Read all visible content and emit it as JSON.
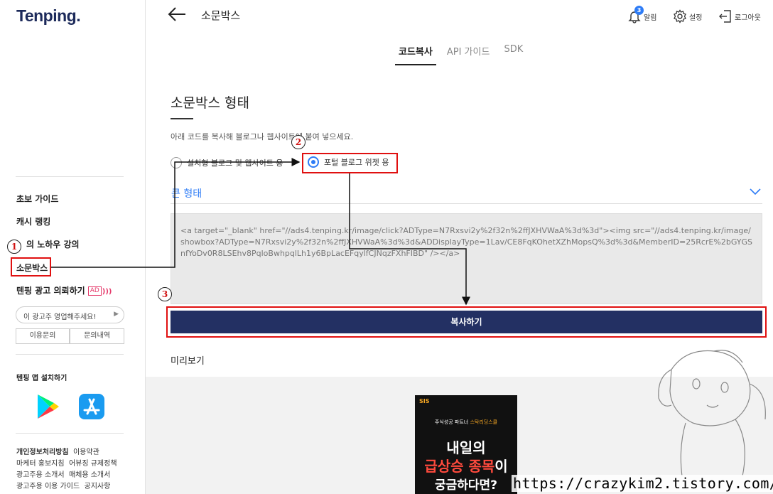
{
  "logo": "Tenping.",
  "sidebar": {
    "menu": [
      "초보 가이드",
      "캐시 랭킹",
      "의 노하우 강의",
      "소문박스"
    ],
    "ad_request_label": "텐핑 광고 의뢰하기",
    "ad_badge": "AD",
    "ad_input_placeholder": "이 광고주 영업해주세요!",
    "inquiry_buttons": [
      "이용문의",
      "문의내역"
    ],
    "app_install_title": "텐핑 앱 설치하기",
    "footer_lines": [
      [
        "개인정보처리방침",
        "이용약관"
      ],
      [
        "마케터 홍보지침",
        "어뷰징 규제정책"
      ],
      [
        "광고주용 소개서",
        "매체용 소개서"
      ],
      [
        "광고주용 이용 가이드",
        "공지사항"
      ]
    ]
  },
  "header": {
    "title": "소문박스",
    "notification_count": "3",
    "notification_label": "알림",
    "settings_label": "설정",
    "logout_label": "로그아웃"
  },
  "tabs": [
    "코드복사",
    "API 가이드",
    "SDK"
  ],
  "active_tab": "코드복사",
  "main": {
    "section_title": "소문박스 형태",
    "description": "아래 코드를 복사해 블로그나 웹사이트에 붙여 넣으세요.",
    "radio_options": [
      "설치형 블로그 및 웹사이트 용",
      "포털 블로그 위젯 용"
    ],
    "selected_radio": "포털 블로그 위젯 용",
    "size_dropdown_value": "큰 형태",
    "code": "<a target=\"_blank\" href=\"//ads4.tenping.kr/image/click?ADType=N7Rxsvi2y%2f32n%2ffJXHVWaA%3d%3d\"><img src=\"//ads4.tenping.kr/image/showbox?ADType=N7Rxsvi2y%2f32n%2ffJXHVWaA%3d%3d&ADDisplayType=1Lav/CE8FqKOhetXZhMopsQ%3d%3d&MemberID=25RcrE%2bGYGSnfYoDv0R8LSEhv8PqloBwhpqlLh1y6BpLacEFqylfCJNqzFXhFIBD\" /></a>",
    "copy_button": "복사하기",
    "preview_title": "미리보기"
  },
  "ad_preview": {
    "brand": "SIS",
    "subtitle_prefix": "주식성공 파트너 ",
    "subtitle_highlight": "스탁리딩스쿨",
    "line1": "내일의",
    "line2_red": "급상승 종목",
    "line2_white": "이",
    "line3": "궁금하다면?"
  },
  "annotations": [
    "1",
    "2",
    "3"
  ],
  "watermark": "https://crazykim2.tistory.com/",
  "colors": {
    "brand_navy": "#233063",
    "accent_blue": "#2e7cf6",
    "annotation_red": "#e01010"
  }
}
